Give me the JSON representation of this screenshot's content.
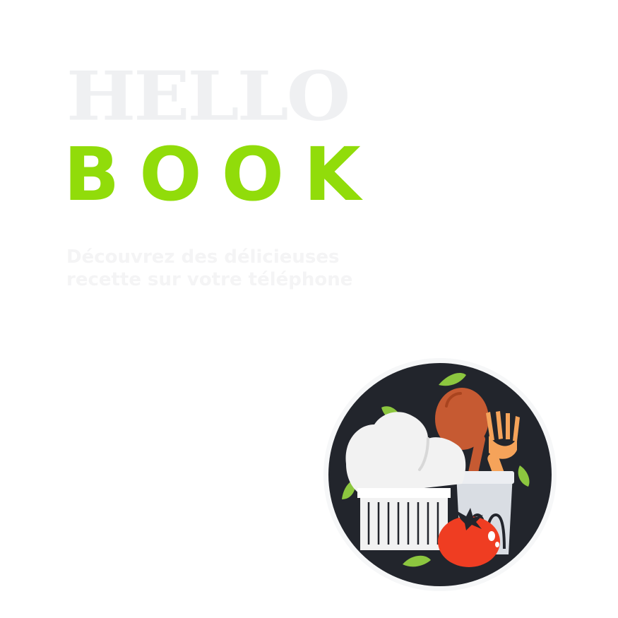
{
  "hero": {
    "title_top": "HELLO",
    "title_bottom": "BOOK"
  },
  "tagline": {
    "line1": "Découvrez des délicieuses",
    "line2": "recette sur votre téléphone"
  },
  "colors": {
    "background": "#ffffff",
    "title_top": "#eff0f2",
    "accent": "#91dc0a",
    "tagline": "#f4f4f5",
    "badge_dark": "#22252c",
    "leaf": "#8cc63f",
    "tomato": "#ef3d22",
    "spoon": "#c65a32",
    "fork": "#f5a35a"
  },
  "illustration": {
    "icon": "chef-cooking-icon"
  }
}
